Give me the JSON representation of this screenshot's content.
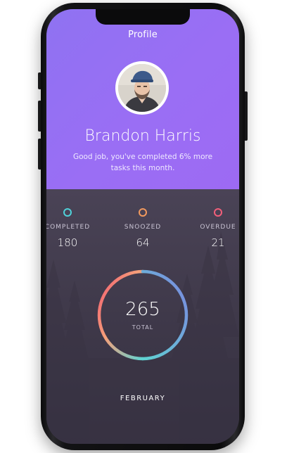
{
  "header": {
    "title": "Profile",
    "user_name": "Brandon Harris",
    "subtitle": "Good job, you've completed 6% more tasks this month."
  },
  "stats": [
    {
      "label": "COMPLETED",
      "value": "180",
      "color": "#4fd1d9"
    },
    {
      "label": "SNOOZED",
      "value": "64",
      "color": "#f2995e"
    },
    {
      "label": "OVERDUE",
      "value": "21",
      "color": "#f25f7a"
    }
  ],
  "total": {
    "value": "265",
    "label": "TOTAL",
    "ring_colors": [
      "#f2566f",
      "#f5a07a",
      "#5fd3d2",
      "#7b86e0"
    ]
  },
  "month": "FEBRUARY",
  "colors": {
    "header_purple": "#9a6ef4",
    "dark_background": "#3f394a"
  }
}
